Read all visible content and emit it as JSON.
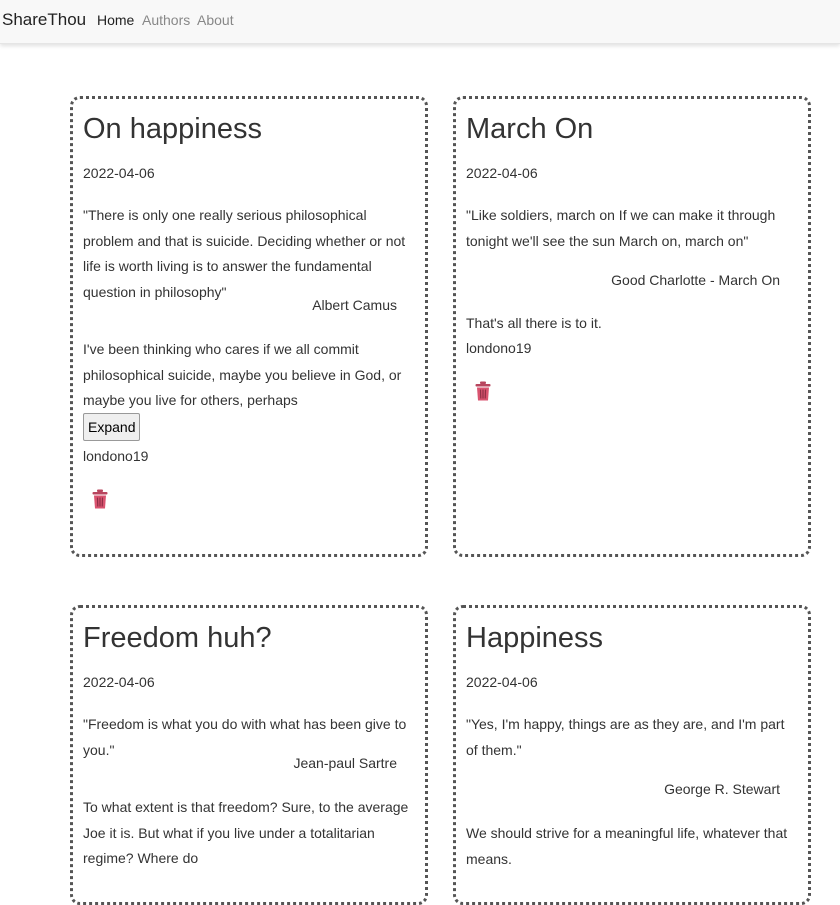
{
  "nav": {
    "brand": "ShareThou",
    "links": [
      "Home",
      "Authors",
      "About"
    ]
  },
  "posts": [
    {
      "title": "On happiness",
      "date": "2022-04-06",
      "quote": "\"There is only one really serious philosophical problem and that is suicide. Deciding whether or not life is worth living is to answer the fundamental question in philosophy\"",
      "author": "Albert Camus",
      "body": "I've been thinking who cares if we all commit philosophical suicide, maybe you believe in God, or maybe you live for others, perhaps",
      "expand_label": "Expand",
      "username": "londono19"
    },
    {
      "title": "March On",
      "date": "2022-04-06",
      "quote": "\"Like soldiers, march on If we can make it through tonight we'll see the sun March on, march on\"",
      "author": "Good Charlotte - March On",
      "body": "That's all there is to it.",
      "username": "londono19"
    },
    {
      "title": "Freedom huh?",
      "date": "2022-04-06",
      "quote": "\"Freedom is what you do with what has been give to you.\"",
      "author": "Jean-paul Sartre",
      "body": "To what extent is that freedom? Sure, to the average Joe it is. But what if you live under a totalitarian regime? Where do"
    },
    {
      "title": "Happiness",
      "date": "2022-04-06",
      "quote": "\"Yes, I'm happy, things are as they are, and I'm part of them.\"",
      "author": "George R. Stewart",
      "body": "We should strive for a meaningful life, whatever that means."
    }
  ],
  "icons": {
    "delete": "trash-icon",
    "delete_color": "#d9536f"
  }
}
